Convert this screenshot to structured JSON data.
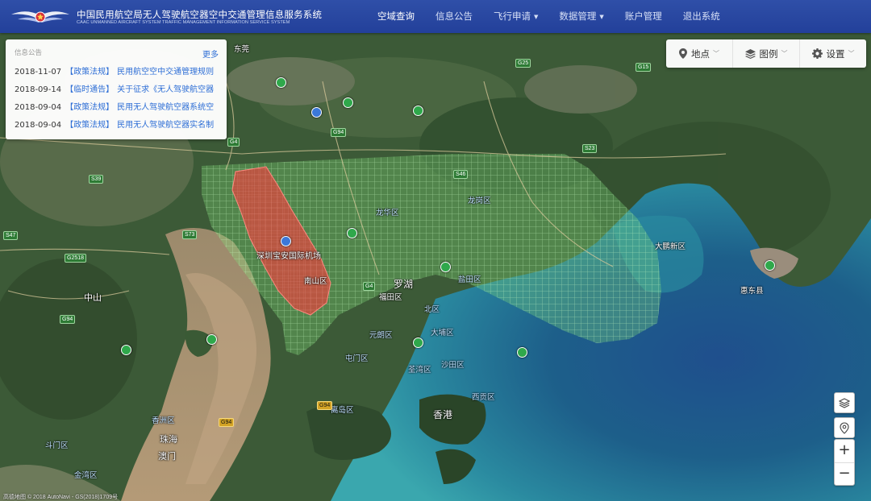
{
  "header": {
    "title_cn": "中国民用航空局无人驾驶航空器空中交通管理信息服务系统",
    "title_en": "CAAC UNMANNED AIRCRAFT SYSTEM TRAFFIC MANAGEMENT INFORMATION SERVICE SYSTEM"
  },
  "nav": {
    "airspace": "空域查询",
    "notice": "信息公告",
    "flight_apply": "飞行申请",
    "data_mgmt": "数据管理",
    "account": "账户管理",
    "logout": "退出系统"
  },
  "notice_panel": {
    "title": "信息公告",
    "more": "更多",
    "items": [
      {
        "date": "2018-11-07",
        "tag": "【政策法规】",
        "text": "民用航空空中交通管理规则"
      },
      {
        "date": "2018-09-14",
        "tag": "【临时通告】",
        "text": "关于征求《无人驾驶航空器"
      },
      {
        "date": "2018-09-04",
        "tag": "【政策法规】",
        "text": "民用无人驾驶航空器系统空"
      },
      {
        "date": "2018-09-04",
        "tag": "【政策法规】",
        "text": "民用无人驾驶航空器实名制"
      }
    ]
  },
  "toolbar": {
    "location": "地点",
    "legend": "图例",
    "settings": "设置"
  },
  "map": {
    "places": {
      "shenzhen_airport": "深圳宝安国际机场",
      "nanshan": "南山区",
      "futian": "福田区",
      "luohu": "罗湖",
      "longhua": "龙华区",
      "longgang": "龙岗区",
      "yantian": "盐田区",
      "dapeng": "大鹏新区",
      "zhongshan": "中山",
      "zhuhai": "珠海",
      "macau": "澳门",
      "hongkong": "香港",
      "yuen_long": "元朗区",
      "tuen_mun": "屯门区",
      "tsuen_wan": "荃湾区",
      "shatin": "沙田区",
      "tai_po": "大埔区",
      "north_district": "北区",
      "islands": "离岛区",
      "sai_kung": "西贡区",
      "dongguan": "东莞",
      "huizhou": "惠东县",
      "xiangzhou": "香洲区",
      "doumen": "斗门区",
      "jinwan": "金湾区"
    },
    "copyright": "高德地图 © 2018 AutoNavi - GS(2018)1709号",
    "colors": {
      "restricted_zone": "#e0463f",
      "controlled_grid": "#7fe07a",
      "header_bg": "#2a479f",
      "link_blue": "#2f6fd6"
    }
  },
  "map_controls": {
    "zoom_in": "+",
    "zoom_out": "−"
  }
}
